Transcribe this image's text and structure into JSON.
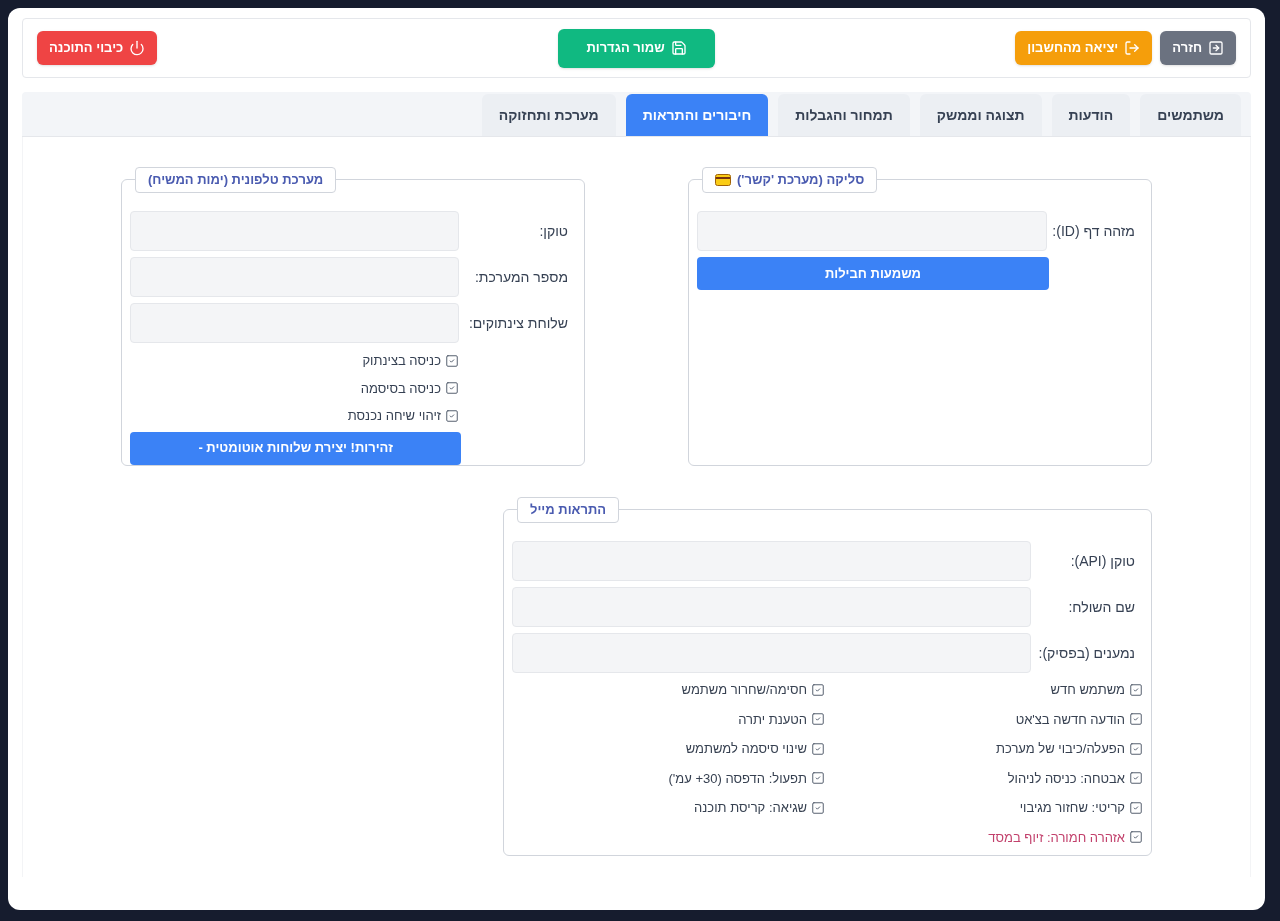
{
  "header": {
    "buttons": [
      {
        "label": "חזרה",
        "kind": "back"
      },
      {
        "label": "יציאה מהחשבון",
        "kind": "logout"
      },
      {
        "label": "שמור הגדרות",
        "kind": "save"
      },
      {
        "label": "כיבוי התוכנה",
        "kind": "power"
      }
    ]
  },
  "tabs": [
    {
      "label": "משתמשים",
      "selected": false
    },
    {
      "label": "הודעות",
      "selected": false
    },
    {
      "label": "תצוגה וממשק",
      "selected": false
    },
    {
      "label": "תמחור והגבלות",
      "selected": false
    },
    {
      "label": "חיבורים והתראות",
      "selected": true
    },
    {
      "label": "מערכת ותחזוקה",
      "selected": false
    }
  ],
  "sections": [
    {
      "kind": "billing",
      "title": "סליקה (מערכת 'קשר')",
      "fields": [
        {
          "label": "מזהה דף (ID):"
        }
      ],
      "button": "משמעות חבילות"
    },
    {
      "kind": "telephony",
      "title": "מערכת טלפונית (ימות המשיח)",
      "fields": [
        {
          "label": "טוקן:"
        },
        {
          "label": "מספר המערכת:"
        },
        {
          "label": "שלוחת צינתוקים:"
        }
      ],
      "checkboxes": [
        {
          "label": "כניסה בצינתוק",
          "checked": true
        },
        {
          "label": "כניסה בסיסמה",
          "checked": true
        },
        {
          "label": "זיהוי שיחה נכנסת",
          "checked": true
        }
      ],
      "button": "זהירות! יצירת שלוחות אוטומטית -"
    },
    {
      "kind": "email",
      "title": "התראות מייל",
      "fields": [
        {
          "label": "טוקן (API):"
        },
        {
          "label": "שם השולח:"
        },
        {
          "label": "נמענים (בפסיק):"
        }
      ],
      "checkboxes": [
        {
          "label": "משתמש חדש",
          "checked": true,
          "color": "#374151"
        },
        {
          "label": "חסימה/שחרור משתמש",
          "checked": true,
          "color": "#374151"
        },
        {
          "label": "הודעה חדשה בצ'אט",
          "checked": true,
          "color": "#374151"
        },
        {
          "label": "הטענת יתרה",
          "checked": true,
          "color": "#374151"
        },
        {
          "label": "הפעלה/כיבוי של מערכת",
          "checked": true,
          "color": "#374151"
        },
        {
          "label": "שינוי סיסמה למשתמש",
          "checked": true,
          "color": "#374151"
        },
        {
          "label": "אבטחה: כניסה לניהול",
          "checked": true,
          "color": "#374151"
        },
        {
          "label": "תפעול: הדפסה (30+ עמ')",
          "checked": true,
          "color": "#374151"
        },
        {
          "label": "קריטי: שחזור מגיבוי",
          "checked": true,
          "color": "#374151"
        },
        {
          "label": "שגיאה: קריסת תוכנה",
          "checked": true,
          "color": "#374151"
        },
        {
          "label": "אזהרה חמורה: זיוף במסד",
          "checked": true,
          "color": "#c2416c"
        }
      ]
    }
  ]
}
